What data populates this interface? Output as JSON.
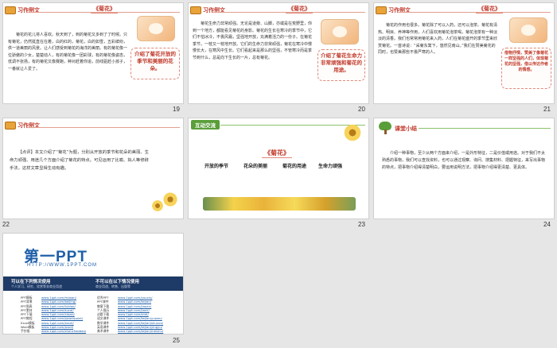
{
  "slides": [
    {
      "number": "19",
      "tag": "习作例文",
      "title": "《菊花》",
      "paragraphs": [
        "菊花的花儿将人喜欢。秋天到了，到的菊花又多到了了时候。只有菊花，仍然挺直在在着，白的红的，菊花，白的如雪，五彩缤纷，供一道美丽的风景。让人们感受到菊花的海洋的美丽。有的菊花像一位骄傲的少女，楚楚动人，有的菊花像一团彩球，有的菊花像姿态，低调不张扬，有的菊花又像赛跑，种对赶着你追，前线驱赶小孩子，一番就让人爱了。"
      ],
      "callout": "介绍了菊花开放的季节和美丽的花朵。"
    },
    {
      "number": "20",
      "tag": "习作例文",
      "title": "《菊花》",
      "paragraphs": [
        "菊花生命力非常顽强。无论是道旁、山脚，亦或是在荒野里，你到一个地方，都能看见菊花的身影。菊花的生长在寒冷的季节中，它们不怕冰冷，不畏风霜，坚强地开放，充满着活力的一份子。在菊花季节，一枝又一枝地开放。它们的生命力非常顽强，菊花在寒冷中慢慢长大，在寒风中生长。它们看起来是那么的坚强，不管寒冷而是季节到什么，总是向下生长的一片，总有菊花。"
      ],
      "callout": "介绍了菊花生命力非常顽强和菊花的用途。"
    },
    {
      "number": "21",
      "tag": "习作例文",
      "title": "《菊花》",
      "paragraphs": [
        "菊花的作用也很多。菊花除了可以入药，还可以泡茶。菊花有清热、明目、养神等作用，人们喜欢用菊花泡茶喝，菊花泡茶有一种淡淡的清香。我们也常常用菊花来入药，人们在菊花盛开的季节里来欣赏菊花。一首诗说：“采菊东篱下，悠然见南山。”我们在赞美菊花的同时，也赞美那些不畏严寒的人。"
      ],
      "callout": "借物抒情，赞美了像菊花一样坚强的人们，体现菊花的坚强，借以传达作者的情感。"
    },
    {
      "number": "22",
      "tag": "习作例文",
      "comment": "【点评】本文介绍了“菊花”为题，分别从开放的季节和花朵的美丽、生命力顽强、用途几个方面介绍了菊花的特点。可见运用了比喻、拟人等修辞手法，这样文章显得生动有趣。"
    },
    {
      "number": "23",
      "tag": "互动交流",
      "title": "《菊花》",
      "topics": [
        "开放的季节",
        "花朵的美丽",
        "菊花的用途",
        "生命力顽强"
      ]
    },
    {
      "number": "24",
      "tag": "课堂小结",
      "summary": "介绍一种事物，至少从两个方面来介绍，一是外形特征，二是价值或用途。对于我们不太熟悉的事物，我们可以查找资料，也可以通过观察、询问、搜集材料、把握特征，来写出事物的特点，把事物介绍得清楚明白，要运用说明方法，把事物介绍得更清楚、更具体。"
    },
    {
      "number": "25",
      "logo": "第一PPT",
      "url": "HTTP://WWW.1PPT.COM",
      "can_use": "可以在下列情况使用",
      "can_use_sub": "个人学习、研究、欣赏等非商业用途",
      "cannot_use": "不可以在以下情况使用",
      "cannot_use_sub": "商业用途、转售、出版等",
      "left_list": [
        "PPT模板",
        "PPT背景",
        "PPT图表",
        "PPT素材",
        "PPT下载",
        "PPT教程",
        "Excel模板",
        "Word模板",
        "手抄报"
      ],
      "left_links": [
        "www.1ppt.com/moban/",
        "www.1ppt.com/beijing/",
        "www.1ppt.com/tubiao/",
        "www.1ppt.com/sucai/",
        "www.1ppt.com/xiazai/",
        "www.1ppt.com/powerpoint/",
        "www.1ppt.com/excel/",
        "www.1ppt.com/word/",
        "www.1ppt.com/shouchaobao/"
      ],
      "right_list": [
        "优秀PPT",
        "PPT课件",
        "教案下载",
        "个人简历",
        "试题下载",
        "语文课件",
        "数学课件",
        "英语课件",
        "美术课件"
      ],
      "right_links": [
        "www.1ppt.com/youxiu/",
        "www.1ppt.com/kejian/",
        "www.1ppt.com/jiaoan/",
        "www.1ppt.com/jianli/",
        "www.1ppt.com/shiti/",
        "www.1ppt.com/kejian/yuwen/",
        "www.1ppt.com/kejian/shuxue/",
        "www.1ppt.com/kejian/yingyu/",
        "www.1ppt.com/kejian/meishu/"
      ]
    }
  ],
  "colors": {
    "accent_red": "#c0392b",
    "green": "#5a9e3a",
    "navy": "#1e3a66",
    "brand_blue": "#1e5fa8"
  }
}
